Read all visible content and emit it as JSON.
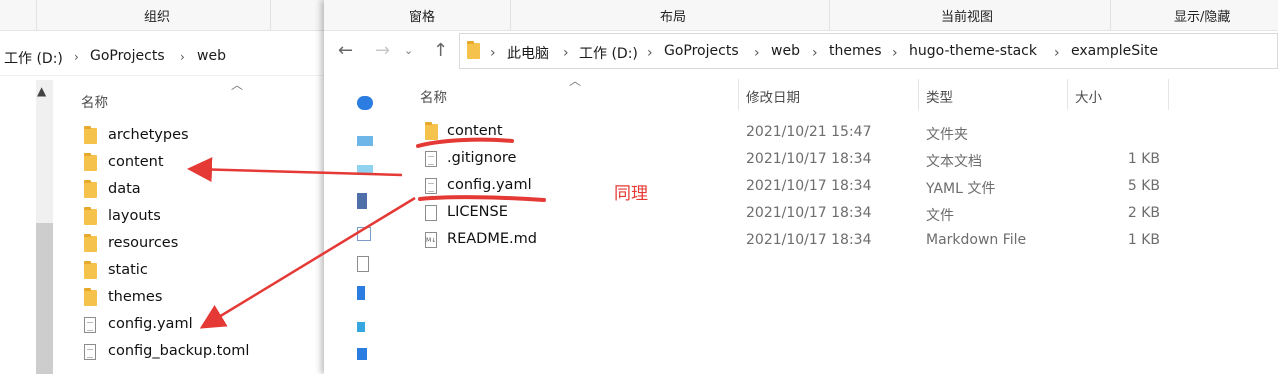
{
  "left_window": {
    "ribbon_label": "组织",
    "breadcrumb": [
      "工作 (D:)",
      "GoProjects",
      "web"
    ],
    "column_header": "名称",
    "items": [
      {
        "name": "archetypes",
        "kind": "folder"
      },
      {
        "name": "content",
        "kind": "folder"
      },
      {
        "name": "data",
        "kind": "folder"
      },
      {
        "name": "layouts",
        "kind": "folder"
      },
      {
        "name": "resources",
        "kind": "folder"
      },
      {
        "name": "static",
        "kind": "folder"
      },
      {
        "name": "themes",
        "kind": "folder"
      },
      {
        "name": "config.yaml",
        "kind": "file"
      },
      {
        "name": "config_backup.toml",
        "kind": "file"
      }
    ]
  },
  "right_window": {
    "ribbon": {
      "pane": "窗格",
      "layout": "布局",
      "current_view": "当前视图",
      "show_hide": "显示/隐藏"
    },
    "breadcrumb": [
      "此电脑",
      "工作 (D:)",
      "GoProjects",
      "web",
      "themes",
      "hugo-theme-stack",
      "exampleSite"
    ],
    "columns": {
      "name": "名称",
      "modified": "修改日期",
      "type": "类型",
      "size": "大小"
    },
    "files": [
      {
        "name": "content",
        "modified": "2021/10/21 15:47",
        "type": "文件夹",
        "size": "",
        "kind": "folder"
      },
      {
        "name": ".gitignore",
        "modified": "2021/10/17 18:34",
        "type": "文本文档",
        "size": "1 KB",
        "kind": "file"
      },
      {
        "name": "config.yaml",
        "modified": "2021/10/17 18:34",
        "type": "YAML 文件",
        "size": "5 KB",
        "kind": "file"
      },
      {
        "name": "LICENSE",
        "modified": "2021/10/17 18:34",
        "type": "文件",
        "size": "2 KB",
        "kind": "blank"
      },
      {
        "name": "README.md",
        "modified": "2021/10/17 18:34",
        "type": "Markdown File",
        "size": "1 KB",
        "kind": "md"
      }
    ]
  },
  "annotation": {
    "text": "同理",
    "color": "#e53935"
  },
  "colors": {
    "folder": "#f5c24b",
    "annotation": "#e53935",
    "accent": "#0078d7"
  }
}
